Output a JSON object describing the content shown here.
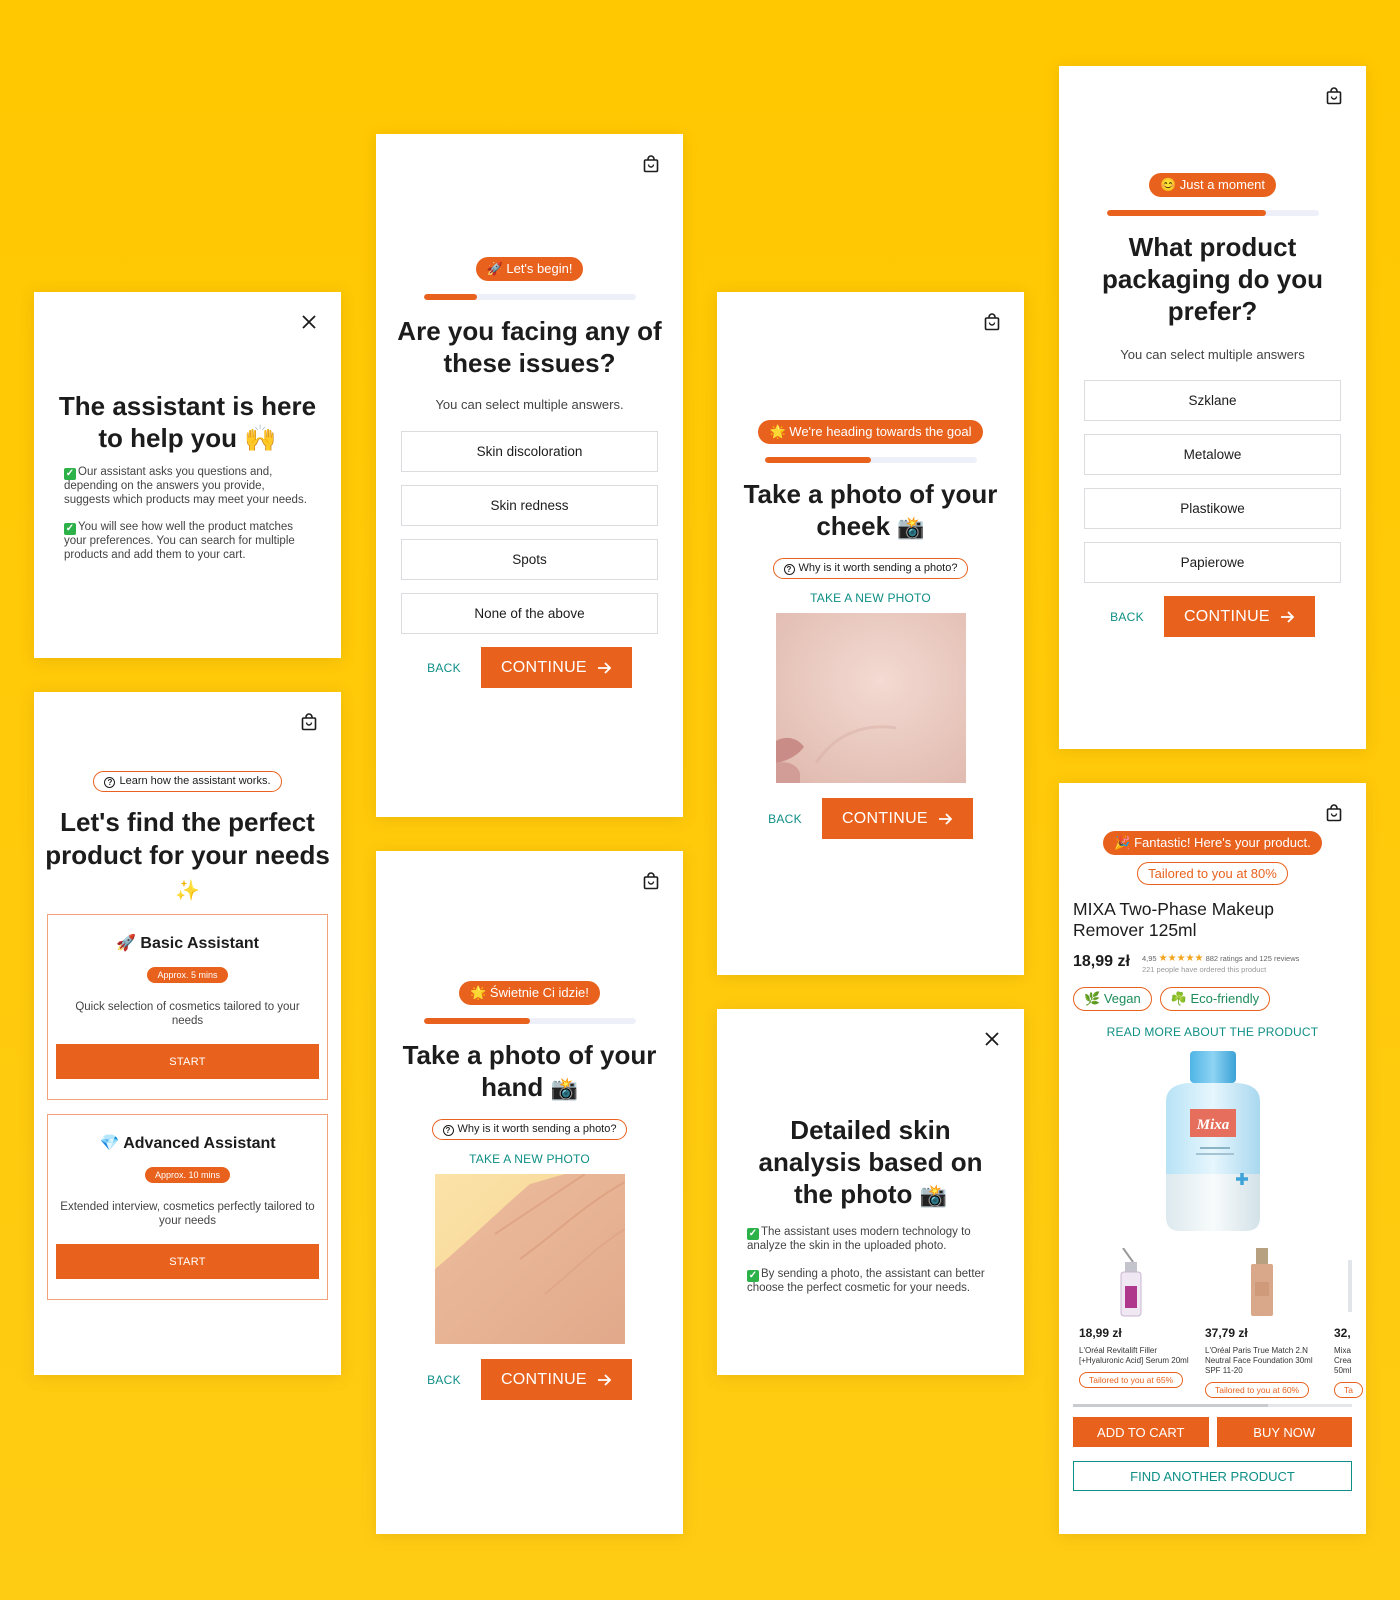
{
  "screen_intro": {
    "title": "The assistant is here to help you",
    "title_emoji": "🙌",
    "bullets": [
      "Our assistant asks you questions and, depending on the answers you provide, suggests which products may meet your needs.",
      "You will see how well the product matches your preferences. You can search for multiple products and add them to your cart."
    ]
  },
  "screen_choose": {
    "learn_pill": "Learn how the assistant works.",
    "title": "Let's find the perfect product for your needs",
    "title_emoji": "✨",
    "assistants": [
      {
        "icon": "🚀",
        "name": "Basic Assistant",
        "time": "Approx. 5 mins",
        "desc": "Quick selection of cosmetics tailored to your needs",
        "button": "START"
      },
      {
        "icon": "💎",
        "name": "Advanced Assistant",
        "time": "Approx. 10 mins",
        "desc": "Extended interview, cosmetics perfectly tailored to your needs",
        "button": "START"
      }
    ]
  },
  "screen_issues": {
    "badge": "Let's begin!",
    "badge_emoji": "🚀",
    "progress": 0.25,
    "title": "Are you facing any of these issues?",
    "subtitle": "You can select multiple answers.",
    "options": [
      "Skin discoloration",
      "Skin redness",
      "Spots",
      "None of the above"
    ],
    "back": "BACK",
    "continue": "CONTINUE"
  },
  "screen_hand": {
    "badge": "Świetnie Ci idzie!",
    "badge_emoji": "🌟",
    "progress": 0.5,
    "title": "Take a photo of your hand",
    "title_emoji": "📸",
    "why_pill": "Why is it worth sending a photo?",
    "new_photo": "TAKE A NEW PHOTO",
    "back": "BACK",
    "continue": "CONTINUE"
  },
  "screen_cheek": {
    "badge": "We're heading towards the goal",
    "badge_emoji": "🌟",
    "progress": 0.5,
    "title": "Take a photo of your cheek",
    "title_emoji": "📸",
    "why_pill": "Why is it worth sending a photo?",
    "new_photo": "TAKE A NEW PHOTO",
    "back": "BACK",
    "continue": "CONTINUE"
  },
  "screen_analysis": {
    "title": "Detailed skin analysis based on the photo",
    "title_emoji": "📸",
    "bullets": [
      "The assistant uses modern technology to analyze the skin in the uploaded photo.",
      "By sending a photo, the assistant can better choose the perfect cosmetic for your needs."
    ]
  },
  "screen_packaging": {
    "badge": "Just a moment",
    "badge_emoji": "😊",
    "progress": 0.75,
    "title": "What product packaging do you prefer?",
    "subtitle": "You can select multiple answers",
    "options": [
      "Szklane",
      "Metalowe",
      "Plastikowe",
      "Papierowe"
    ],
    "back": "BACK",
    "continue": "CONTINUE"
  },
  "screen_result": {
    "badge": "Fantastic! Here's your product.",
    "badge_emoji": "🎉",
    "match": "Tailored to you at 80%",
    "product_name": "MIXA Two-Phase Makeup Remover 125ml",
    "price": "18,99 zł",
    "rating": "4,95",
    "rating_stars": 5,
    "reviews": "882 ratings and 125 reviews",
    "ordered": "221 people have ordered this product",
    "tags": [
      {
        "icon": "🌿",
        "label": "Vegan"
      },
      {
        "icon": "☘️",
        "label": "Eco-friendly"
      }
    ],
    "read_more": "READ MORE ABOUT THE PRODUCT",
    "bottle_brand": "Mixa",
    "others": [
      {
        "price": "18,99 zł",
        "name": "L'Oréal Revitalift Filler [+Hyaluronic Acid] Serum 20ml",
        "match": "Tailored to you at 65%"
      },
      {
        "price": "37,79 zł",
        "name": "L'Oréal Paris True Match 2.N Neutral Face Foundation 30ml SPF 11-20",
        "match": "Tailored to you at 60%"
      },
      {
        "price": "32,",
        "name": "Mixa Crea 50ml",
        "match": "Ta"
      }
    ],
    "add_to_cart": "ADD TO CART",
    "buy_now": "BUY NOW",
    "find_another": "FIND ANOTHER PRODUCT"
  }
}
